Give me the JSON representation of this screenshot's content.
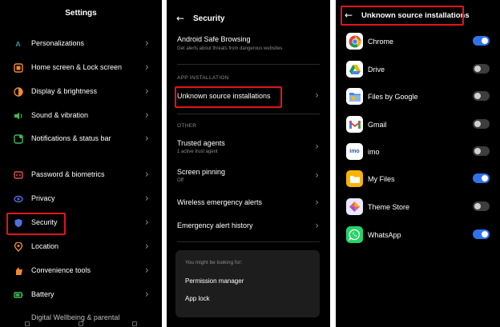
{
  "settings": {
    "title": "Settings",
    "items": [
      {
        "label": "Personalizations",
        "icon": "personalization-icon"
      },
      {
        "label": "Home screen & Lock screen",
        "icon": "home-screen-icon"
      },
      {
        "label": "Display & brightness",
        "icon": "display-icon"
      },
      {
        "label": "Sound & vibration",
        "icon": "sound-icon"
      },
      {
        "label": "Notifications & status bar",
        "icon": "notification-icon"
      },
      {
        "label": "Password & biometrics",
        "icon": "password-icon"
      },
      {
        "label": "Privacy",
        "icon": "privacy-icon"
      },
      {
        "label": "Security",
        "icon": "security-icon"
      },
      {
        "label": "Location",
        "icon": "location-icon"
      },
      {
        "label": "Convenience tools",
        "icon": "convenience-icon"
      },
      {
        "label": "Battery",
        "icon": "battery-icon"
      }
    ],
    "cut_item": "Digital Wellbeing & parental"
  },
  "security": {
    "title": "Security",
    "safe_browsing": {
      "label": "Android Safe Browsing",
      "sub": "Get alerts about threats from dangerous websites"
    },
    "app_installation_header": "APP INSTALLATION",
    "unknown_sources": "Unknown source installations",
    "other_header": "OTHER",
    "trusted_agents": {
      "label": "Trusted agents",
      "sub": "1 active trust agent"
    },
    "screen_pinning": {
      "label": "Screen pinning",
      "sub": "Off"
    },
    "wireless_alerts": "Wireless emergency alerts",
    "alert_history": "Emergency alert history",
    "suggestions": {
      "header": "You might be looking for:",
      "links": [
        "Permission manager",
        "App lock"
      ]
    }
  },
  "unknown": {
    "title": "Unknown source installations",
    "apps": [
      {
        "name": "Chrome",
        "enabled": true,
        "icon": "chrome-icon"
      },
      {
        "name": "Drive",
        "enabled": false,
        "icon": "drive-icon"
      },
      {
        "name": "Files by Google",
        "enabled": false,
        "icon": "files-icon"
      },
      {
        "name": "Gmail",
        "enabled": false,
        "icon": "gmail-icon"
      },
      {
        "name": "imo",
        "enabled": false,
        "icon": "imo-icon"
      },
      {
        "name": "My Files",
        "enabled": true,
        "icon": "my-files-icon"
      },
      {
        "name": "Theme Store",
        "enabled": false,
        "icon": "theme-store-icon"
      },
      {
        "name": "WhatsApp",
        "enabled": true,
        "icon": "whatsapp-icon"
      }
    ]
  },
  "colors": {
    "highlight": "#e3131b",
    "toggle_on": "#2f73ea",
    "toggle_off": "#3d3d3d"
  }
}
